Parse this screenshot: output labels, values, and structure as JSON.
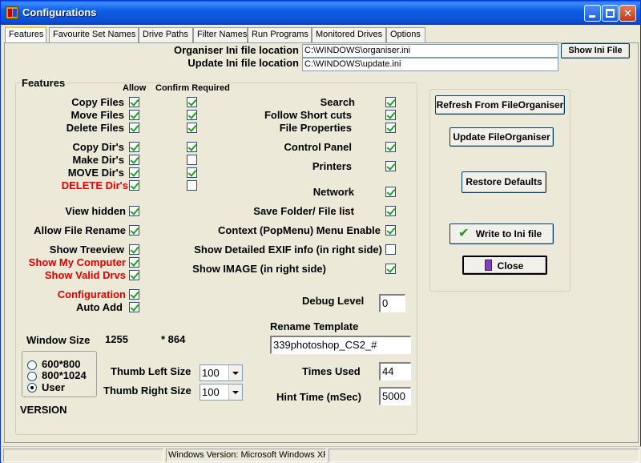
{
  "window": {
    "title": "Configurations"
  },
  "tabs": [
    {
      "label": "Features"
    },
    {
      "label": "Favourite Set Names"
    },
    {
      "label": "Drive Paths"
    },
    {
      "label": "Filter Names"
    },
    {
      "label": "Run Programs"
    },
    {
      "label": "Monitored Drives"
    },
    {
      "label": "Options"
    }
  ],
  "ini": {
    "organiser_label": "Organiser Ini file location",
    "organiser_value": "C:\\WINDOWS\\organiser.ini",
    "update_label": "Update Ini file location",
    "update_value": "C:\\WINDOWS\\update.ini",
    "show_button": "Show Ini File"
  },
  "features": {
    "group_label": "Features",
    "col_allow": "Allow",
    "col_confirm": "Confirm Required",
    "left_rows": [
      {
        "label": "Copy Files",
        "allow": true,
        "confirm": true
      },
      {
        "label": "Move Files",
        "allow": true,
        "confirm": true
      },
      {
        "label": "Delete Files",
        "allow": true,
        "confirm": true
      },
      {
        "label": "Copy Dir's",
        "allow": true,
        "confirm": true
      },
      {
        "label": "Make Dir's",
        "allow": true,
        "confirm": false
      },
      {
        "label": "MOVE Dir's",
        "allow": true,
        "confirm": true
      },
      {
        "label": "DELETE Dir's",
        "allow": true,
        "confirm": false
      },
      {
        "label": "View hidden",
        "allow": true
      },
      {
        "label": "Allow File Rename",
        "allow": true
      },
      {
        "label": "Show Treeview",
        "allow": true
      },
      {
        "label": "Show My Computer",
        "allow": true
      },
      {
        "label": "Show Valid Drvs",
        "allow": true
      },
      {
        "label": "Configuration",
        "allow": true
      },
      {
        "label": "Auto Add",
        "allow": true
      }
    ],
    "right_rows": [
      {
        "label": "Search",
        "checked": true
      },
      {
        "label": "Follow Short cuts",
        "checked": true
      },
      {
        "label": "File Properties",
        "checked": true
      },
      {
        "label": "Control Panel",
        "checked": true
      },
      {
        "label": "Printers",
        "checked": true
      },
      {
        "label": "Network",
        "checked": true
      },
      {
        "label": "Save Folder/ File list",
        "checked": true
      },
      {
        "label": "Context (PopMenu) Menu Enable",
        "checked": true
      },
      {
        "label": "Show Detailed EXIF info (in right side)",
        "checked": false
      },
      {
        "label": "Show IMAGE (in right side)",
        "checked": true
      }
    ],
    "debug_label": "Debug Level",
    "debug_value": "0",
    "rename_label": "Rename Template",
    "rename_value": "339photoshop_CS2_#",
    "times_label": "Times Used",
    "times_value": "44",
    "hint_label": "Hint Time (mSec)",
    "hint_value": "5000"
  },
  "window_size": {
    "label": "Window Size",
    "width": "1255",
    "height": "* 864",
    "options": [
      "600*800",
      "800*1024",
      "User"
    ],
    "selected": "User"
  },
  "thumb": {
    "left_label": "Thumb Left Size",
    "left_value": "100",
    "right_label": "Thumb Right Size",
    "right_value": "100"
  },
  "version_label": "VERSION",
  "actions": {
    "refresh": "Refresh From FileOrganiser",
    "update": "Update FileOrganiser",
    "restore": "Restore Defaults",
    "write": "Write to Ini file",
    "close": "Close"
  },
  "status": {
    "windows_version": "Windows Version: Microsoft Windows XP"
  }
}
